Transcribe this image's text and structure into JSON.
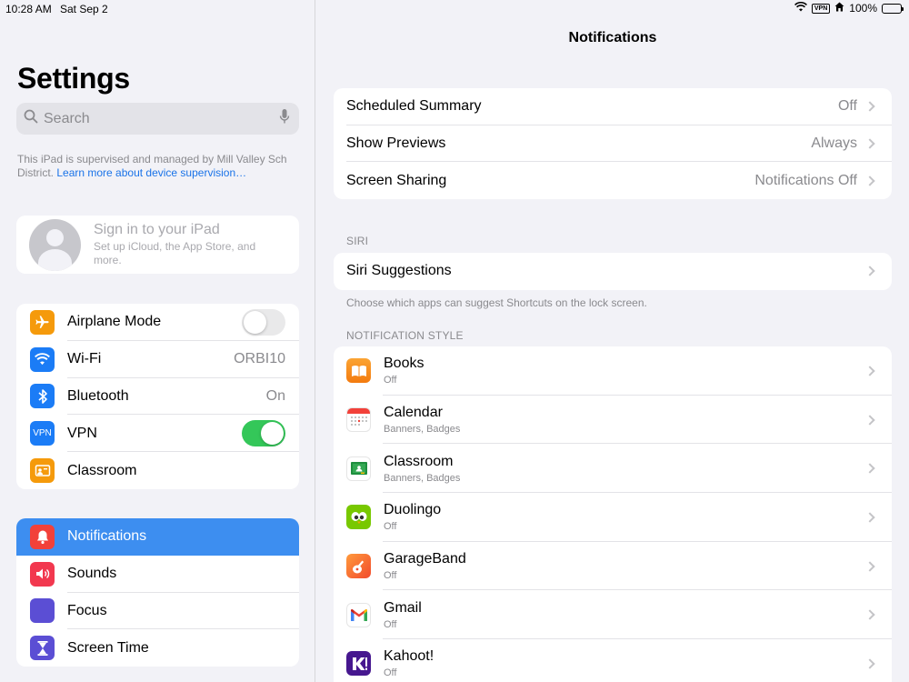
{
  "status": {
    "time": "10:28 AM",
    "date": "Sat Sep 2",
    "vpn": "VPN",
    "battery": "100%"
  },
  "sidebar": {
    "title": "Settings",
    "search": {
      "placeholder": "Search"
    },
    "supervision": {
      "text": "This iPad is supervised and managed by Mill Valley Sch District. ",
      "link": "Learn more about device supervision…"
    },
    "signin": {
      "title": "Sign in to your iPad",
      "subtitle": "Set up iCloud, the App Store, and more."
    },
    "group1": [
      {
        "label": "Airplane Mode",
        "icon": "airplane-icon",
        "color": "#f59a0b"
      },
      {
        "label": "Wi-Fi",
        "value": "ORBI10",
        "icon": "wifi-icon",
        "color": "#1b7cf6"
      },
      {
        "label": "Bluetooth",
        "value": "On",
        "icon": "bluetooth-icon",
        "color": "#1b7cf6"
      },
      {
        "label": "VPN",
        "icon": "vpn-icon",
        "color": "#1b7cf6",
        "icon_text": "VPN"
      },
      {
        "label": "Classroom",
        "icon": "classroom-icon",
        "color": "#f59a0b"
      }
    ],
    "group2": [
      {
        "label": "Notifications",
        "icon": "bell-icon",
        "color": "#f2413a"
      },
      {
        "label": "Sounds",
        "icon": "speaker-icon",
        "color": "#f2384f"
      },
      {
        "label": "Focus",
        "icon": "moon-icon",
        "color": "#5b4ed4"
      },
      {
        "label": "Screen Time",
        "icon": "hourglass-icon",
        "color": "#5b4ed4"
      }
    ]
  },
  "main": {
    "title": "Notifications",
    "top_rows": [
      {
        "label": "Scheduled Summary",
        "value": "Off"
      },
      {
        "label": "Show Previews",
        "value": "Always"
      },
      {
        "label": "Screen Sharing",
        "value": "Notifications Off"
      }
    ],
    "siri_header": "SIRI",
    "siri_row": {
      "label": "Siri Suggestions"
    },
    "siri_footer": "Choose which apps can suggest Shortcuts on the lock screen.",
    "style_header": "NOTIFICATION STYLE",
    "apps": [
      {
        "name": "Books",
        "sub": "Off",
        "icon": "books-icon"
      },
      {
        "name": "Calendar",
        "sub": "Banners, Badges",
        "icon": "calendar-icon"
      },
      {
        "name": "Classroom",
        "sub": "Banners, Badges",
        "icon": "classroom-app-icon"
      },
      {
        "name": "Duolingo",
        "sub": "Off",
        "icon": "duolingo-icon"
      },
      {
        "name": "GarageBand",
        "sub": "Off",
        "icon": "garageband-icon"
      },
      {
        "name": "Gmail",
        "sub": "Off",
        "icon": "gmail-icon"
      },
      {
        "name": "Kahoot!",
        "sub": "Off",
        "icon": "kahoot-icon"
      }
    ]
  },
  "colors": {
    "accent": "#3d8ef0",
    "toggle_on": "#34c759",
    "link": "#1a73e8"
  }
}
